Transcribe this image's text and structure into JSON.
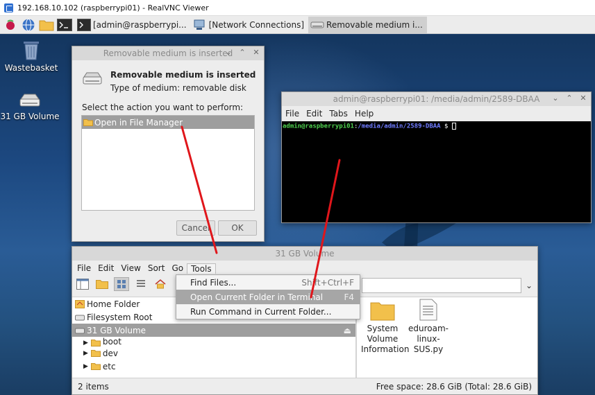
{
  "vnc": {
    "title": "192.168.10.102 (raspberrypi01) - RealVNC Viewer"
  },
  "taskbar": {
    "tasks": [
      {
        "label": "[admin@raspberrypi...",
        "active": false
      },
      {
        "label": "[Network Connections]",
        "active": false
      },
      {
        "label": "Removable medium i...",
        "active": true
      }
    ]
  },
  "desktop": {
    "icons": [
      {
        "label": "Wastebasket",
        "icon": "wastebasket-icon"
      },
      {
        "label": "31 GB Volume",
        "icon": "drive-icon"
      }
    ]
  },
  "dialog": {
    "title": "Removable medium is inserted",
    "heading": "Removable medium is inserted",
    "type_line": "Type of medium:   removable disk",
    "prompt": "Select the action you want to perform:",
    "actions": [
      "Open in File Manager"
    ],
    "cancel_label": "Cancel",
    "ok_label": "OK"
  },
  "terminal": {
    "title": "admin@raspberrypi01: /media/admin/2589-DBAA",
    "menu": [
      "File",
      "Edit",
      "Tabs",
      "Help"
    ],
    "prompt_user": "admin@raspberrypi01",
    "prompt_sep": ":",
    "prompt_path": "/media/admin/2589-DBAA",
    "prompt_end": " $ "
  },
  "file_manager": {
    "title": "31 GB Volume",
    "menu": [
      "File",
      "Edit",
      "View",
      "Sort",
      "Go",
      "Tools"
    ],
    "tools_menu": [
      {
        "label": "Find Files...",
        "accel": "Shift+Ctrl+F",
        "highlighted": false
      },
      {
        "label": "Open Current Folder in Terminal",
        "accel": "F4",
        "highlighted": true
      },
      {
        "label": "Run Command in Current Folder...",
        "accel": "",
        "highlighted": false
      }
    ],
    "sidebar": [
      {
        "label": "Home Folder",
        "selected": false
      },
      {
        "label": "Filesystem Root",
        "selected": false
      },
      {
        "label": "31 GB Volume",
        "selected": true
      }
    ],
    "tree": [
      {
        "label": "boot"
      },
      {
        "label": "dev"
      },
      {
        "label": "etc"
      }
    ],
    "files": [
      {
        "label": "System Volume Information",
        "icon": "folder-icon"
      },
      {
        "label": "eduroam-linux-SUS.py",
        "icon": "text-file-icon"
      }
    ],
    "status_left": "2 items",
    "status_right": "Free space: 28.6 GiB (Total: 28.6 GiB)"
  },
  "colors": {
    "annotation_arrow": "#e0161b",
    "terminal_user": "#4fd04f",
    "terminal_path": "#6f7bff"
  }
}
